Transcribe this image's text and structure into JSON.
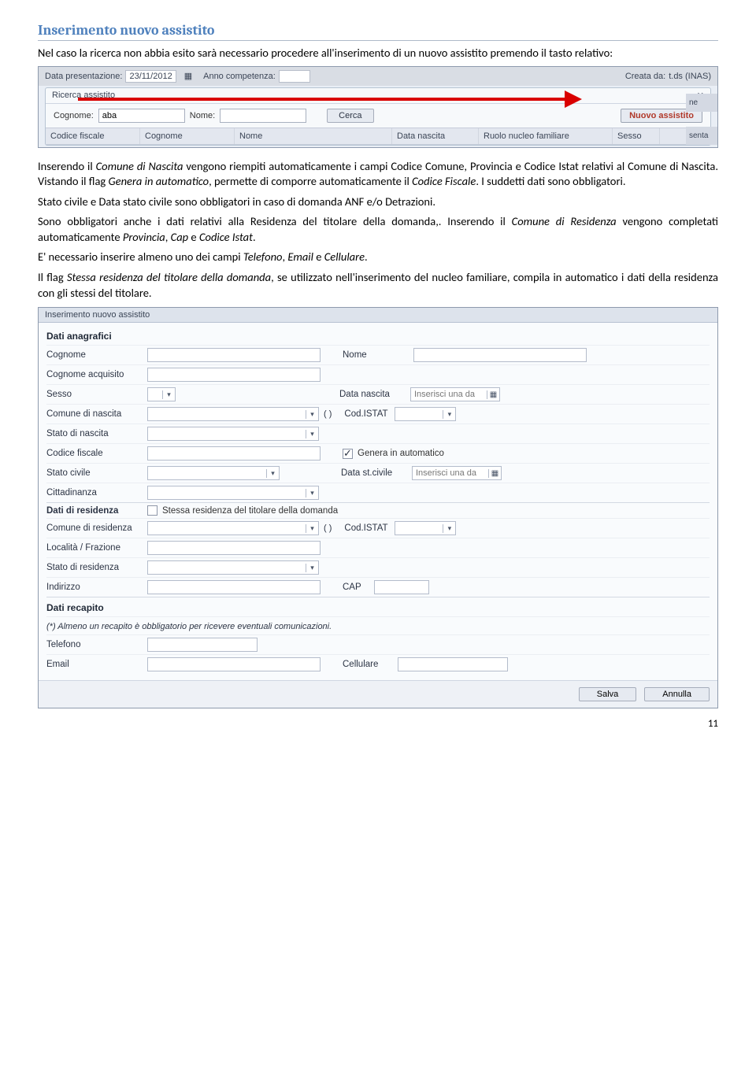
{
  "section_title": "Inserimento nuovo assistito",
  "para1a": "Nel caso la ricerca non abbia esito sarà necessario procedere all'inserimento di un nuovo assistito premendo il tasto relativo:",
  "scr1": {
    "top": {
      "data_pres_lbl": "Data presentazione:",
      "data_pres_val": "23/11/2012",
      "anno_lbl": "Anno competenza:",
      "anno_val": "",
      "creata_lbl": "Creata da:",
      "creata_val": "t.ds (INAS)"
    },
    "dlg_title": "Ricerca assistito",
    "cognome_lbl": "Cognome:",
    "cognome_val": "aba",
    "nome_lbl": "Nome:",
    "cerca_btn": "Cerca",
    "nuovo_btn": "Nuovo assistito",
    "cols": [
      "Codice fiscale",
      "Cognome",
      "Nome",
      "Data nascita",
      "Ruolo nucleo familiare",
      "Sesso"
    ],
    "rt1": "ne",
    "rt2": "senta"
  },
  "para2_pre": "Inserendo il ",
  "para2_em1": "Comune di Nascita",
  "para2_mid1": " vengono riempiti automaticamente i campi Codice Comune, Provincia e Codice Istat relativi al Comune di Nascita. Vistando il flag ",
  "para2_em2": "Genera in automatico",
  "para2_mid2": ", permette di comporre automaticamente il ",
  "para2_em3": "Codice Fiscale",
  "para2_end": ". I suddetti dati sono obbligatori.",
  "para3": "Stato civile e Data stato civile sono obbligatori in caso di domanda ANF e/o Detrazioni.",
  "para4_pre": "Sono obbligatori anche i dati relativi alla Residenza del titolare della domanda,. Inserendo il ",
  "para4_em1": "Comune di Residenza",
  "para4_mid": " vengono completati automaticamente ",
  "para4_em2": "Provincia",
  "para4_c1": ", ",
  "para4_em3": "Cap",
  "para4_c2": " e ",
  "para4_em4": "Codice Istat",
  "para4_end": ".",
  "para5_pre": "E' necessario inserire almeno uno dei campi ",
  "para5_em1": "Telefono",
  "para5_c1": ", ",
  "para5_em2": "Email",
  "para5_c2": " e ",
  "para5_em3": "Cellulare",
  "para5_end": ".",
  "para6_pre": "Il flag ",
  "para6_em1": "Stessa residenza del titolare della domanda",
  "para6_end": ", se utilizzato nell'inserimento del nucleo familiare, compila in automatico i dati della residenza con gli stessi del titolare.",
  "scr2": {
    "win_title": "Inserimento nuovo assistito",
    "g1": "Dati anagrafici",
    "cognome": "Cognome",
    "nome": "Nome",
    "cognome_acq": "Cognome acquisito",
    "sesso": "Sesso",
    "data_nascita": "Data nascita",
    "data_nascita_ph": "Inserisci una da",
    "comune_nascita": "Comune di nascita",
    "par": "( )",
    "cod_istat": "Cod.ISTAT",
    "stato_nascita": "Stato di nascita",
    "cod_fisc": "Codice fiscale",
    "gen_auto": "Genera in automatico",
    "stato_civile": "Stato civile",
    "data_st_civile": "Data st.civile",
    "data_st_ph": "Inserisci una da",
    "cittadinanza": "Cittadinanza",
    "g2": "Dati di residenza",
    "stessa_res": "Stessa residenza del titolare della domanda",
    "comune_res": "Comune di residenza",
    "localita": "Località / Frazione",
    "stato_res": "Stato di residenza",
    "indirizzo": "Indirizzo",
    "cap": "CAP",
    "g3": "Dati recapito",
    "note": "(*) Almeno un recapito è obbligatorio per ricevere eventuali comunicazioni.",
    "telefono": "Telefono",
    "email": "Email",
    "cellulare": "Cellulare",
    "salva": "Salva",
    "annulla": "Annulla"
  },
  "page_number": "11"
}
